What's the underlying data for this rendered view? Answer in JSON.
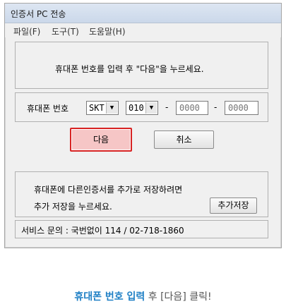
{
  "window": {
    "title": "인증서 PC 전송"
  },
  "menu": {
    "items": [
      "파일(F)",
      "도구(T)",
      "도움말(H)"
    ]
  },
  "instruction": {
    "text": "휴대폰 번호를 입력 후 \"다음\"을 누르세요."
  },
  "phone": {
    "label": "휴대폰 번호",
    "carrier": "SKT",
    "prefix": "010",
    "dash": "-",
    "middle_placeholder": "0000",
    "last_placeholder": "0000"
  },
  "buttons": {
    "next": "다음",
    "cancel": "취소",
    "add_save": "추가저장"
  },
  "save_info": {
    "line1": "휴대폰에 다른인증서를 추가로 저장하려면",
    "line2": "추가 저장을 누르세요."
  },
  "service": {
    "text": "서비스 문의 : 국번없이 114 / 02-718-1860"
  },
  "caption": {
    "highlight": "휴대폰 번호 입력",
    "rest": " 후 [다음] 클릭!"
  }
}
